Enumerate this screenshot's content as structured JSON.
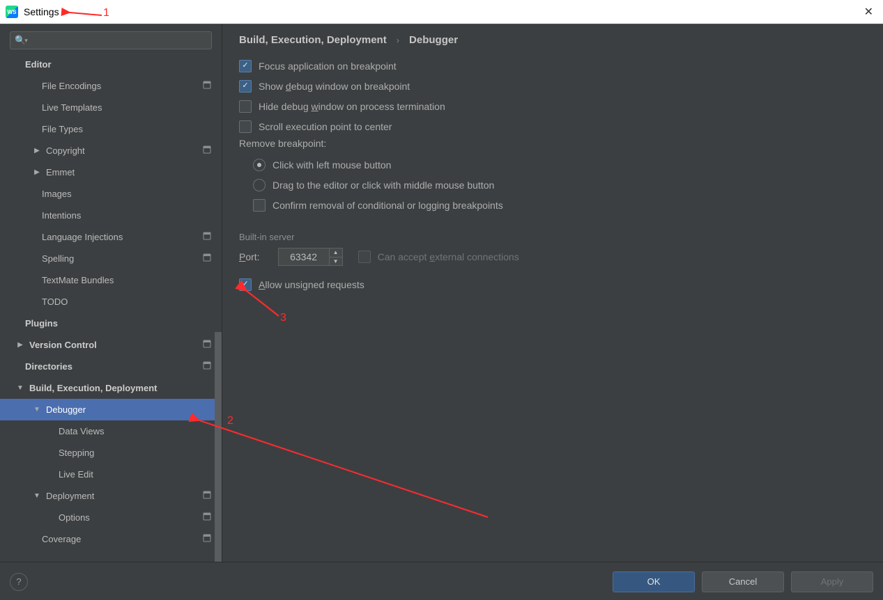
{
  "window": {
    "title": "Settings"
  },
  "sidebar": {
    "items": [
      {
        "label": "Editor",
        "bold": true,
        "indent": "pad0",
        "arrow": "",
        "cfg": false
      },
      {
        "label": "File Encodings",
        "indent": "pad2",
        "cfg": true
      },
      {
        "label": "Live Templates",
        "indent": "pad2",
        "cfg": false
      },
      {
        "label": "File Types",
        "indent": "pad2",
        "cfg": false
      },
      {
        "label": "Copyright",
        "indent": "pad2",
        "cfg": true,
        "arrow": "▶",
        "arrowbox": true
      },
      {
        "label": "Emmet",
        "indent": "pad2",
        "cfg": false,
        "arrow": "▶",
        "arrowbox": true
      },
      {
        "label": "Images",
        "indent": "pad2",
        "cfg": false
      },
      {
        "label": "Intentions",
        "indent": "pad2",
        "cfg": false
      },
      {
        "label": "Language Injections",
        "indent": "pad2",
        "cfg": true
      },
      {
        "label": "Spelling",
        "indent": "pad2",
        "cfg": true
      },
      {
        "label": "TextMate Bundles",
        "indent": "pad2",
        "cfg": false
      },
      {
        "label": "TODO",
        "indent": "pad2",
        "cfg": false
      },
      {
        "label": "Plugins",
        "bold": true,
        "indent": "pad0",
        "cfg": false
      },
      {
        "label": "Version Control",
        "bold": true,
        "indent": "pad0",
        "cfg": true,
        "arrow": "▶",
        "arrowbox": true
      },
      {
        "label": "Directories",
        "bold": true,
        "indent": "pad0",
        "cfg": true
      },
      {
        "label": "Build, Execution, Deployment",
        "bold": true,
        "indent": "pad0",
        "cfg": false,
        "arrow": "▼",
        "arrowbox": true
      },
      {
        "label": "Debugger",
        "indent": "pad2",
        "cfg": false,
        "arrow": "▼",
        "arrowbox": true,
        "sel": true
      },
      {
        "label": "Data Views",
        "indent": "pad3",
        "cfg": false
      },
      {
        "label": "Stepping",
        "indent": "pad3",
        "cfg": false
      },
      {
        "label": "Live Edit",
        "indent": "pad3",
        "cfg": false
      },
      {
        "label": "Deployment",
        "indent": "pad2",
        "cfg": true,
        "arrow": "▼",
        "arrowbox": true
      },
      {
        "label": "Options",
        "indent": "pad3",
        "cfg": true
      },
      {
        "label": "Coverage",
        "indent": "pad2",
        "cfg": true
      }
    ]
  },
  "breadcrumb": {
    "a": "Build, Execution, Deployment",
    "b": "Debugger"
  },
  "checks": {
    "focus": "Focus application on breakpoint",
    "show_pre": "Show ",
    "show_u": "d",
    "show_post": "ebug window on breakpoint",
    "hide_pre": "Hide debug ",
    "hide_u": "w",
    "hide_post": "indow on process termination",
    "scroll": "Scroll execution point to center",
    "remove": "Remove breakpoint:",
    "click_left": "Click with left mouse button",
    "click_mid": "Drag to the editor or click with middle mouse button",
    "confirm": "Confirm removal of conditional or logging breakpoints"
  },
  "server": {
    "title": "Built-in server",
    "port_p": "P",
    "port_post": "ort:",
    "port_value": "63342",
    "ext_pre": "Can accept ",
    "ext_u": "e",
    "ext_post": "xternal connections",
    "allow_u": "A",
    "allow_post": "llow unsigned requests"
  },
  "footer": {
    "ok": "OK",
    "cancel": "Cancel",
    "apply": "Apply"
  },
  "anno": {
    "n1": "1",
    "n2": "2",
    "n3": "3"
  }
}
